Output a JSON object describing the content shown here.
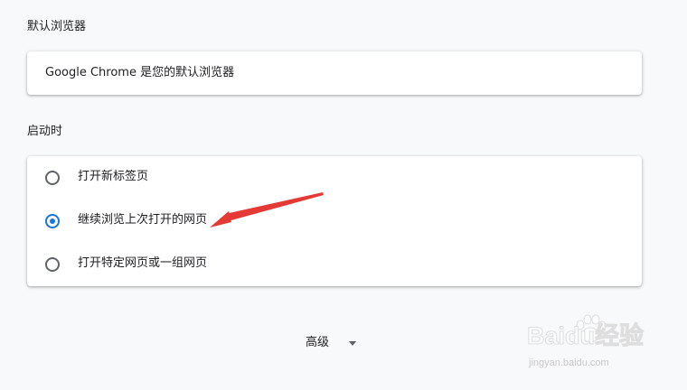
{
  "default_browser": {
    "heading": "默认浏览器",
    "status_text": "Google Chrome 是您的默认浏览器"
  },
  "on_startup": {
    "heading": "启动时",
    "options": [
      {
        "label": "打开新标签页",
        "selected": false
      },
      {
        "label": "继续浏览上次打开的网页",
        "selected": true
      },
      {
        "label": "打开特定网页或一组网页",
        "selected": false
      }
    ]
  },
  "advanced": {
    "label": "高级"
  },
  "annotation": {
    "arrow_color": "#e53935"
  },
  "watermark": {
    "brand": "Baidu经验",
    "url": "jingyan.baidu.com"
  },
  "colors": {
    "accent": "#1a73e8",
    "background": "#f8f9fa"
  }
}
